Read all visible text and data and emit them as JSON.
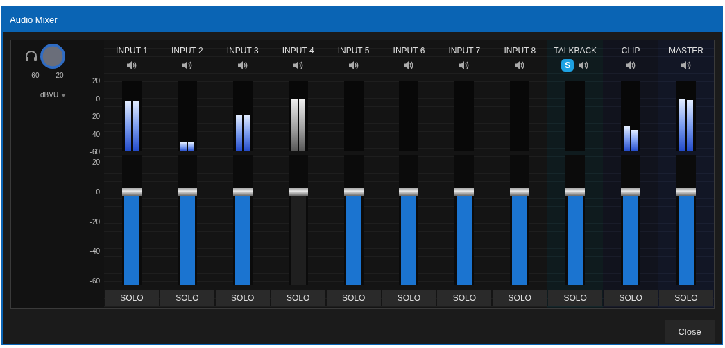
{
  "window": {
    "title": "Audio Mixer"
  },
  "monitor": {
    "min_label": "-60",
    "max_label": "20",
    "unit": "dBVU"
  },
  "meter_scale": [
    "20",
    "0",
    "-20",
    "-40",
    "-60"
  ],
  "fader_scale": [
    "20",
    "0",
    "-20",
    "-40",
    "-60"
  ],
  "channels": [
    {
      "kind": "input",
      "name": "INPUT 1",
      "muted": false,
      "meters": [
        {
          "level": 0.72
        },
        {
          "level": 0.72
        }
      ],
      "fader": {
        "level": 0.72
      },
      "solo_label": "SOLO"
    },
    {
      "kind": "input",
      "name": "INPUT 2",
      "muted": false,
      "meters": [
        {
          "level": 0.13
        },
        {
          "level": 0.13
        }
      ],
      "fader": {
        "level": 0.72
      },
      "solo_label": "SOLO"
    },
    {
      "kind": "input",
      "name": "INPUT 3",
      "muted": false,
      "meters": [
        {
          "level": 0.52
        },
        {
          "level": 0.52
        }
      ],
      "fader": {
        "level": 0.72
      },
      "solo_label": "SOLO"
    },
    {
      "kind": "input",
      "name": "INPUT 4",
      "muted": true,
      "meters": [
        {
          "level": 0.74
        },
        {
          "level": 0.74
        }
      ],
      "fader": {
        "level": 0.72
      },
      "solo_label": "SOLO"
    },
    {
      "kind": "input",
      "name": "INPUT 5",
      "muted": false,
      "meters": [
        {
          "level": 0
        },
        {
          "level": 0
        }
      ],
      "fader": {
        "level": 0.72
      },
      "solo_label": "SOLO"
    },
    {
      "kind": "input",
      "name": "INPUT 6",
      "muted": false,
      "meters": [
        {
          "level": 0
        },
        {
          "level": 0
        }
      ],
      "fader": {
        "level": 0.72
      },
      "solo_label": "SOLO"
    },
    {
      "kind": "input",
      "name": "INPUT 7",
      "muted": false,
      "meters": [
        {
          "level": 0
        },
        {
          "level": 0
        }
      ],
      "fader": {
        "level": 0.72
      },
      "solo_label": "SOLO"
    },
    {
      "kind": "input",
      "name": "INPUT 8",
      "muted": false,
      "meters": [
        {
          "level": 0
        },
        {
          "level": 0
        }
      ],
      "fader": {
        "level": 0.72
      },
      "solo_label": "SOLO"
    },
    {
      "kind": "talkback",
      "name": "TALKBACK",
      "badge": "S",
      "muted": false,
      "meters": [
        {
          "level": 0
        },
        {
          "level": 0
        }
      ],
      "fader": {
        "level": 0.72
      },
      "solo_label": "SOLO"
    },
    {
      "kind": "clip",
      "name": "CLIP",
      "muted": false,
      "meters": [
        {
          "level": 0.35
        },
        {
          "level": 0.3
        }
      ],
      "fader": {
        "level": 0.72
      },
      "solo_label": "SOLO"
    },
    {
      "kind": "master",
      "name": "MASTER",
      "muted": false,
      "meters": [
        {
          "level": 0.75
        },
        {
          "level": 0.73
        }
      ],
      "fader": {
        "level": 0.72
      },
      "solo_label": "SOLO"
    }
  ],
  "buttons": [
    {
      "label": "Close"
    }
  ]
}
